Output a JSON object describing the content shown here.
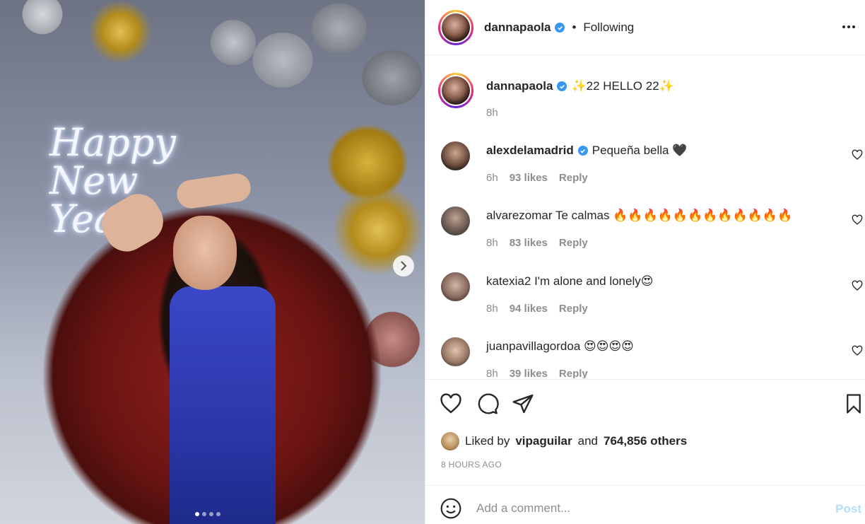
{
  "photo": {
    "neon_sign_text": "Happy New Year",
    "carousel_dots": 4,
    "active_dot": 1
  },
  "header": {
    "username": "dannapaola",
    "separator": "•",
    "follow_status": "Following"
  },
  "caption": {
    "username": "dannapaola",
    "text": "✨22 HELLO 22✨",
    "time": "8h"
  },
  "comments": [
    {
      "username": "alexdelamadrid",
      "verified": true,
      "text": "Pequeña bella 🖤",
      "time": "6h",
      "likes": "93 likes",
      "reply": "Reply"
    },
    {
      "username": "alvarezomar",
      "verified": false,
      "text": "Te calmas 🔥🔥🔥🔥🔥🔥🔥🔥🔥🔥🔥🔥",
      "time": "8h",
      "likes": "83 likes",
      "reply": "Reply"
    },
    {
      "username": "katexia2",
      "verified": false,
      "text": "I'm alone and lonely😍",
      "time": "8h",
      "likes": "94 likes",
      "reply": "Reply"
    },
    {
      "username": "juanpavillagordoa",
      "verified": false,
      "text": "😍😍😍😍",
      "time": "8h",
      "likes": "39 likes",
      "reply": "Reply"
    }
  ],
  "likes": {
    "prefix": "Liked by",
    "user": "vipaguilar",
    "middle": "and",
    "others": "764,856 others"
  },
  "timestamp": "8 HOURS AGO",
  "comment_input": {
    "placeholder": "Add a comment...",
    "post_label": "Post"
  },
  "colors": {
    "verified_badge": "#3897f0",
    "post_button_disabled": "#b2dffc",
    "muted_text": "#8e8e8e"
  }
}
